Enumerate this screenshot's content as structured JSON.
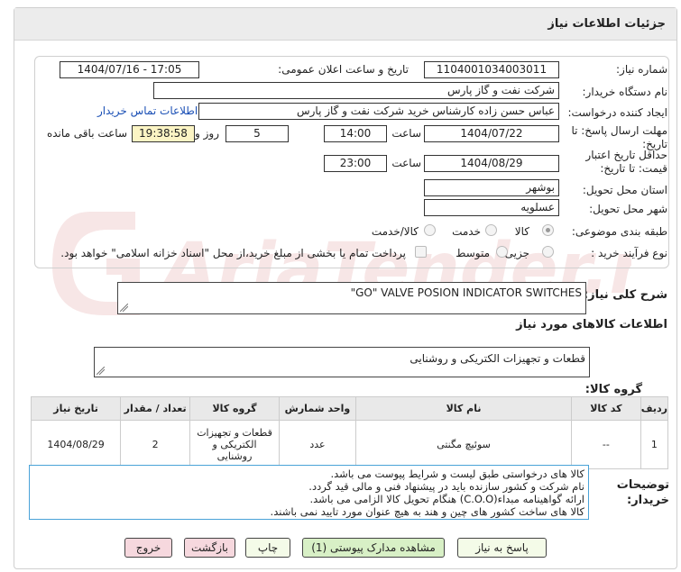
{
  "header": {
    "title": "جزئیات اطلاعات نیاز"
  },
  "form": {
    "need_number_label": "شماره نیاز:",
    "need_number": "1104001034003011",
    "announce_label": "تاریخ و ساعت اعلان عمومی:",
    "announce_value": "1404/07/16 - 17:05",
    "buyer_org_label": "نام دستگاه خریدار:",
    "buyer_org": "شرکت نفت و گاز پارس",
    "creator_label": "ایجاد کننده درخواست:",
    "creator": "عباس حسن زاده کارشناس خرید شرکت نفت و گاز پارس",
    "buyer_contact_link": "اطلاعات تماس خریدار",
    "deadline_label": "مهلت ارسال پاسخ: تا تاریخ:",
    "deadline_date": "1404/07/22",
    "time_label": "ساعت",
    "deadline_time": "14:00",
    "days_value": "5",
    "days_label": "روز و",
    "remaining_time": "19:38:58",
    "remaining_label": "ساعت باقی مانده",
    "validity_label": "حداقل تاریخ اعتبار قیمت: تا تاریخ:",
    "validity_date": "1404/08/29",
    "validity_time_label": "ساعت",
    "validity_time": "23:00",
    "province_label": "استان محل تحویل:",
    "province": "بوشهر",
    "city_label": "شهر محل تحویل:",
    "city": "عسلویه",
    "category_label": "طبقه بندی موضوعی:",
    "category_options": [
      "کالا",
      "خدمت",
      "کالا/خدمت"
    ],
    "category_selected": "کالا",
    "purchase_type_label": "نوع فرآیند خرید :",
    "purchase_options": [
      "جزیی",
      "متوسط"
    ],
    "purchase_selected": "",
    "treasury_note": "پرداخت تمام یا بخشی از مبلغ خرید،از محل \"اسناد خزانه اسلامی\" خواهد بود.",
    "general_desc_label": "شرح کلی نیاز:",
    "general_desc": "\"GO\" VALVE POSION INDICATOR SWITCHES",
    "items_section_title": "اطلاعات کالاهای مورد نیاز",
    "goods_group_label": "گروه کالا:",
    "goods_group": "قطعات و تجهیزات الکتریکی و روشنایی"
  },
  "table": {
    "headers": [
      "ردیف",
      "کد کالا",
      "نام کالا",
      "واحد شمارش",
      "گروه کالا",
      "تعداد / مقدار",
      "تاریخ نیاز"
    ],
    "rows": [
      [
        "1",
        "--",
        "سوئیچ مگنتی",
        "عدد",
        "قطعات و تجهیزات الکتریکی و روشنایی",
        "2",
        "1404/08/29"
      ]
    ]
  },
  "buyer_notes": {
    "label": "توضیحات خریدار:",
    "lines": [
      "کالا های درخواستی طبق لیست و شرایط پیوست می باشد.",
      "نام شرکت و کشور سازنده باید در پیشنهاد فنی و مالی قید گردد.",
      "ارائه گواهینامه مبداء(C.O.O) هنگام تحویل کالا الزامی می باشد.",
      "کالا های ساخت کشور های چین و هند به هیچ عنوان مورد تایید نمی باشند."
    ]
  },
  "buttons": {
    "reply": "پاسخ به نیاز",
    "attachments": "مشاهده مدارک پیوستی (1)",
    "print": "چاپ",
    "back": "بازگشت",
    "exit": "خروج"
  },
  "watermark": {
    "text": "AriaTender.net"
  },
  "colors": {
    "link": "#1a4fb5",
    "header_bg": "#ececec",
    "notes_border": "#4aa3d8",
    "watermark": "#f1d2d2"
  }
}
